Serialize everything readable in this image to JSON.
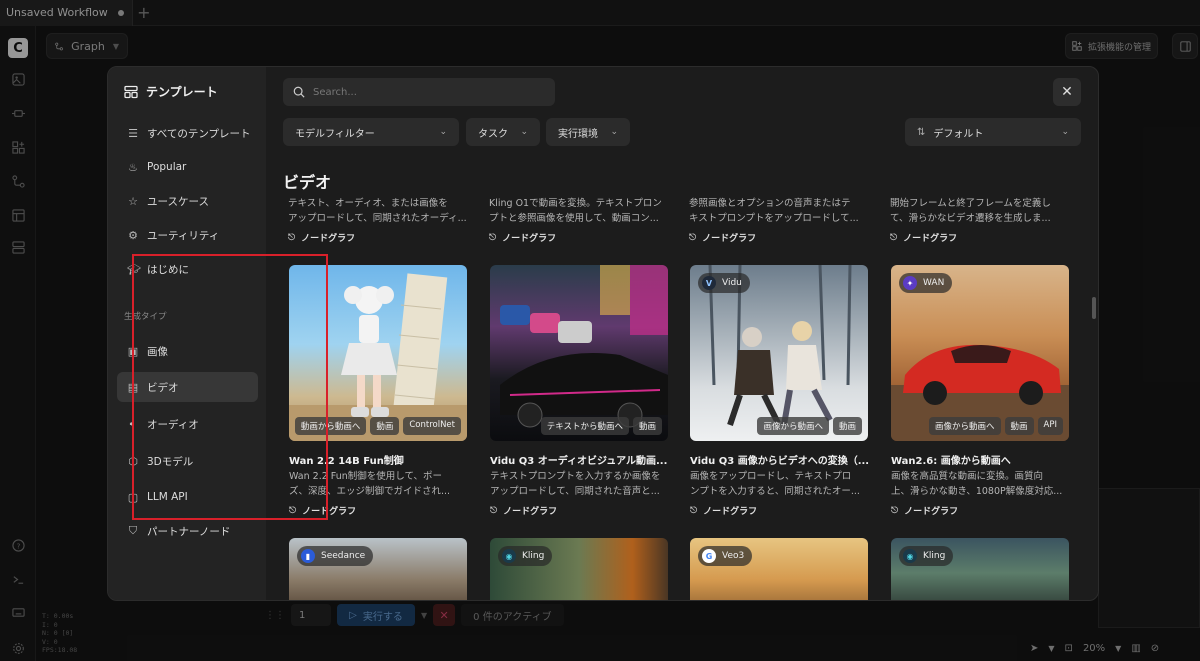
{
  "tabbar": {
    "workflow_tab": "Unsaved Workflow",
    "add_tab": "+"
  },
  "toolbar": {
    "graph_label": "Graph",
    "extensions_label": "拡張機能の管理"
  },
  "stats": [
    "T: 0.00s",
    "I: 0",
    "N: 0 [0]",
    "V: 0",
    "FPS:18.08"
  ],
  "runbar": {
    "count": "1",
    "run_label": "実行する",
    "queue_label": "0 件のアクティブ"
  },
  "zoom": {
    "level": "20%"
  },
  "modal": {
    "sidebar": {
      "title": "テンプレート",
      "items": [
        {
          "label": "すべてのテンプレート",
          "icon": "list-icon"
        },
        {
          "label": "Popular",
          "icon": "flame-icon"
        },
        {
          "label": "ユースケース",
          "icon": "star-icon"
        },
        {
          "label": "ユーティリティ",
          "icon": "gear-icon"
        },
        {
          "label": "はじめに",
          "icon": "graduation-cap-icon"
        }
      ],
      "section_label": "生成タイプ",
      "types": [
        {
          "label": "画像",
          "icon": "image-icon"
        },
        {
          "label": "ビデオ",
          "icon": "film-icon"
        },
        {
          "label": "オーディオ",
          "icon": "speaker-icon"
        },
        {
          "label": "3Dモデル",
          "icon": "cube-icon"
        },
        {
          "label": "LLM API",
          "icon": "chat-icon"
        },
        {
          "label": "パートナーノード",
          "icon": "handshake-icon"
        }
      ]
    },
    "search": {
      "placeholder": "Search..."
    },
    "filters": {
      "model": "モデルフィルター",
      "task": "タスク",
      "env": "実行環境",
      "sort": "デフォルト"
    },
    "section_title": "ビデオ",
    "top_row": [
      {
        "line1": "テキスト、オーディオ、または画像を",
        "line2": "アップロードして、同期されたオーディ...",
        "type": "ノードグラフ"
      },
      {
        "line1": "Kling O1で動画を変換。テキストプロン",
        "line2": "プトと参照画像を使用して、動画コン...",
        "type": "ノードグラフ"
      },
      {
        "line1": "参照画像とオプションの音声またはテ",
        "line2": "キストプロンプトをアップロードして...",
        "type": "ノードグラフ"
      },
      {
        "line1": "開始フレームと終了フレームを定義し",
        "line2": "て、滑らかなビデオ遷移を生成しま...",
        "type": "ノードグラフ"
      }
    ],
    "cards": [
      {
        "title": "Wan 2.2 14B Fun制御",
        "line1": "Wan 2.2 Fun制御を使用して、ポー",
        "line2": "ズ、深度、エッジ制御でガイドされ...",
        "type": "ノードグラフ",
        "tags": [
          "動画から動画へ",
          "動画",
          "ControlNet"
        ],
        "brand": ""
      },
      {
        "title": "Vidu Q3 オーディオビジュアル動画...",
        "line1": "テキストプロンプトを入力するか画像を",
        "line2": "アップロードして、同期された音声と...",
        "type": "ノードグラフ",
        "tags": [
          "テキストから動画へ",
          "動画"
        ],
        "brand": ""
      },
      {
        "title": "Vidu Q3 画像からビデオへの変換（...",
        "line1": "画像をアップロードし、テキストプロ",
        "line2": "ンプトを入力すると、同期されたオー...",
        "type": "ノードグラフ",
        "tags": [
          "画像から動画へ",
          "動画"
        ],
        "brand": "Vidu"
      },
      {
        "title": "Wan2.6: 画像から動画へ",
        "line1": "画像を高品質な動画に変換。画質向",
        "line2": "上、滑らかな動き、1080P解像度対応...",
        "type": "ノードグラフ",
        "tags": [
          "画像から動画へ",
          "動画",
          "API"
        ],
        "brand": "WAN"
      }
    ],
    "bottom_brands": [
      "Seedance",
      "Kling",
      "Veo3",
      "Kling"
    ]
  },
  "colors": {
    "accent_red": "#d8202a",
    "run_blue": "#1d3f66"
  }
}
